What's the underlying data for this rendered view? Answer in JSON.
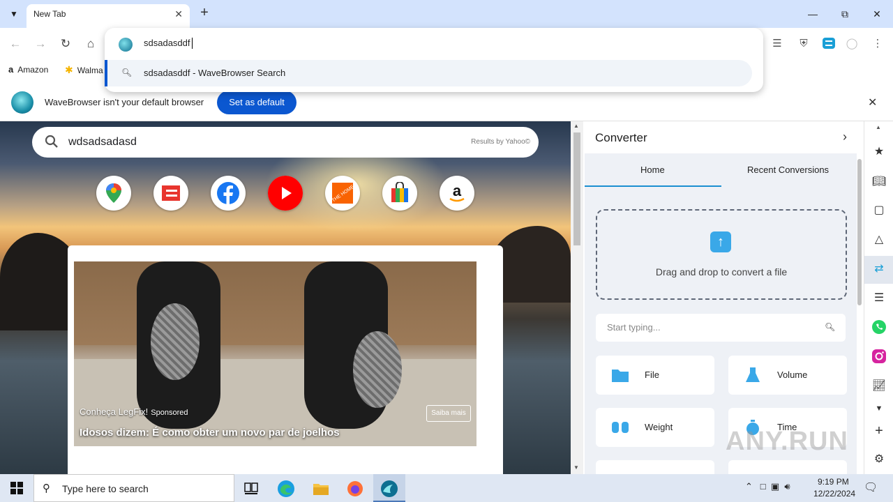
{
  "browser": {
    "tab_title": "New Tab",
    "omnibox_text": "sdsadasddf",
    "suggestion": "sdsadasddf - WaveBrowser Search",
    "bookmarks": [
      {
        "label": "Amazon"
      },
      {
        "label": "Walma"
      }
    ]
  },
  "infobar": {
    "message": "WaveBrowser isn't your default browser",
    "button": "Set as default"
  },
  "ntp": {
    "search_text": "wdsadsadasd",
    "search_credit": "Results by Yahoo©",
    "shortcuts": [
      "maps-icon",
      "espn-icon",
      "facebook-icon",
      "youtube-icon",
      "home-depot-icon",
      "store-icon",
      "amazon-icon"
    ],
    "ad": {
      "advertiser": "Conheça LegFix!",
      "sponsored": "Sponsored",
      "headline": "Idosos dizem: É como obter um novo par de joelhos",
      "cta": "Saiba mais"
    }
  },
  "panel": {
    "title": "Converter",
    "tabs": [
      "Home",
      "Recent Conversions"
    ],
    "active_tab": "Home",
    "dropzone_text": "Drag and drop to convert a file",
    "search_placeholder": "Start typing...",
    "categories": [
      {
        "label": "File",
        "color": "#3aa8e8"
      },
      {
        "label": "Volume",
        "color": "#3aa8e8"
      },
      {
        "label": "Weight",
        "color": "#3aa8e8"
      },
      {
        "label": "Time",
        "color": "#3aa8e8"
      }
    ]
  },
  "watermark": "ANY.RUN",
  "taskbar": {
    "search_placeholder": "Type here to search",
    "time": "9:19 PM",
    "date": "12/22/2024"
  },
  "colors": {
    "accent": "#0b57d0",
    "titlebar": "#d3e3fd",
    "converter_accent": "#3aa8e8"
  }
}
